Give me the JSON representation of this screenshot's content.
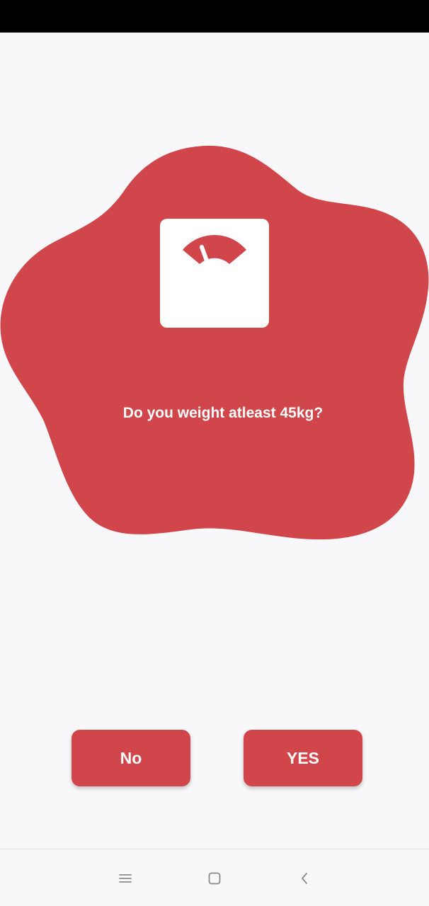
{
  "status_bar": {},
  "card": {
    "color": "#d0464b",
    "icon": "weight-scale-icon",
    "question": "Do you weight atleast 45kg?"
  },
  "buttons": {
    "no_label": "No",
    "yes_label": "YES",
    "color": "#d0464b"
  },
  "nav_bar": {
    "icons": [
      "menu-icon",
      "home-square-icon",
      "back-chevron-icon"
    ]
  }
}
